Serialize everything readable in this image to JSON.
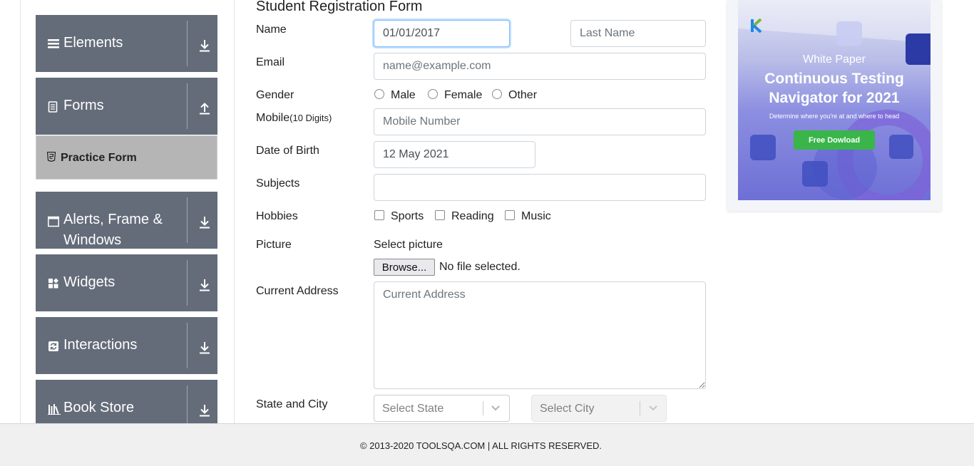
{
  "sidebar": {
    "groups": [
      {
        "label": "Elements",
        "icon": "bars-icon",
        "toggle": "download-arrow-icon"
      },
      {
        "label": "Forms",
        "icon": "document-icon",
        "toggle": "upload-arrow-icon"
      },
      {
        "label": "Alerts, Frame & Windows",
        "icon": "window-icon",
        "toggle": "download-arrow-icon"
      },
      {
        "label": "Widgets",
        "icon": "widgets-icon",
        "toggle": "download-arrow-icon"
      },
      {
        "label": "Interactions",
        "icon": "refresh-icon",
        "toggle": "download-arrow-icon"
      },
      {
        "label": "Book Store",
        "icon": "books-icon",
        "toggle": "download-arrow-icon"
      }
    ],
    "active_item": {
      "label": "Practice Form",
      "icon": "html5-icon"
    }
  },
  "form": {
    "title": "Student Registration Form",
    "name": {
      "label": "Name",
      "first_value": "01/01/2017",
      "last_placeholder": "Last Name"
    },
    "email": {
      "label": "Email",
      "placeholder": "name@example.com"
    },
    "gender": {
      "label": "Gender",
      "options": [
        "Male",
        "Female",
        "Other"
      ]
    },
    "mobile": {
      "label": "Mobile",
      "hint": "(10 Digits)",
      "placeholder": "Mobile Number"
    },
    "dob": {
      "label": "Date of Birth",
      "value": "12 May 2021"
    },
    "subjects": {
      "label": "Subjects",
      "value": ""
    },
    "hobbies": {
      "label": "Hobbies",
      "options": [
        "Sports",
        "Reading",
        "Music"
      ]
    },
    "picture": {
      "label": "Picture",
      "caption": "Select picture",
      "button": "Browse...",
      "status": "No file selected."
    },
    "address": {
      "label": "Current Address",
      "placeholder": "Current Address"
    },
    "state_city": {
      "label": "State and City",
      "state_placeholder": "Select State",
      "city_placeholder": "Select City"
    }
  },
  "ad": {
    "kicker": "White Paper",
    "headline_line1": "Continuous Testing",
    "headline_line2": "Navigator for 2021",
    "subline": "Determine where you're at and where to head",
    "button": "Free Dowload",
    "accent": "#39b54a"
  },
  "footer": {
    "text": "© 2013-2020 TOOLSQA.COM | ALL RIGHTS RESERVED."
  },
  "colors": {
    "sidebar_bg": "#646c7a",
    "submenu_bg": "#b5b5b5",
    "focus": "#80bdff"
  }
}
